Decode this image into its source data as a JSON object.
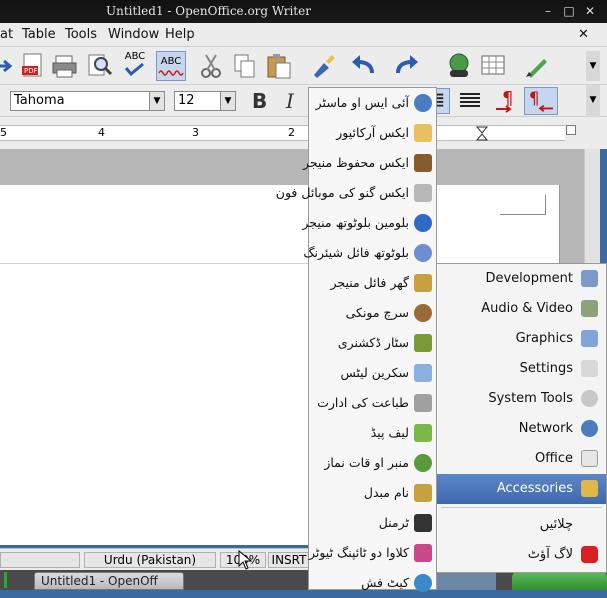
{
  "window": {
    "title": "Untitled1 - OpenOffice.org Writer",
    "min": "–",
    "max": "□",
    "close": "✕"
  },
  "menubar": {
    "items": [
      {
        "label": "at"
      },
      {
        "label": "Table"
      },
      {
        "label": "Tools"
      },
      {
        "label": "Window"
      },
      {
        "label": "Help"
      }
    ],
    "close": "✕"
  },
  "toolbar": {
    "spell_label": "ABC",
    "autospell_label": "ABC"
  },
  "formatting": {
    "font_name": "Tahoma",
    "font_size": "12",
    "bold": "B",
    "italic": "I"
  },
  "ruler": {
    "ticks": [
      "5",
      "4",
      "3",
      "2"
    ]
  },
  "statusbar": {
    "language": "Urdu (Pakistan)",
    "zoom": "100%",
    "mode": "INSRT"
  },
  "taskbar": {
    "button_label": "Untitled1 - OpenOff"
  },
  "main_menu": {
    "items": [
      {
        "label": "Development",
        "icon": "development-icon"
      },
      {
        "label": "Audio & Video",
        "icon": "audio-video-icon"
      },
      {
        "label": "Graphics",
        "icon": "graphics-icon"
      },
      {
        "label": "Settings",
        "icon": "settings-icon"
      },
      {
        "label": "System Tools",
        "icon": "system-tools-icon"
      },
      {
        "label": "Network",
        "icon": "network-icon"
      },
      {
        "label": "Office",
        "icon": "office-icon"
      },
      {
        "label": "Accessories",
        "icon": "accessories-icon"
      },
      {
        "label": "چلائیں",
        "icon": ""
      },
      {
        "label": "لاگ آؤٹ",
        "icon": "logout-icon"
      }
    ]
  },
  "accessories_menu": {
    "items": [
      {
        "label": "آئی ایس او ماسٹر"
      },
      {
        "label": "ایکس آرکائیور"
      },
      {
        "label": "ایکس محفوظ منیجر"
      },
      {
        "label": "ایکس گنو کی موبائل فون"
      },
      {
        "label": "بلومین بلوٹوتھ منیجر"
      },
      {
        "label": "بلوٹوتھ فائل شیئرنگ"
      },
      {
        "label": "گھر فائل منیجر"
      },
      {
        "label": "سرچ مونکی"
      },
      {
        "label": "سٹار ڈکشنری"
      },
      {
        "label": "سکرین لیٹس"
      },
      {
        "label": "طباعت کی ادارت"
      },
      {
        "label": "لیف پیڈ"
      },
      {
        "label": "منبر او قات نماز"
      },
      {
        "label": "نام مبدل"
      },
      {
        "label": "ٹرمنل"
      },
      {
        "label": "کلاوا دو ٹائپنگ ٹیوٹر"
      },
      {
        "label": "کیٹ فش"
      }
    ]
  },
  "colors": {
    "highlight": "#4a74b8",
    "titlebar": "#151515",
    "desktop": "#3b6aa0"
  }
}
